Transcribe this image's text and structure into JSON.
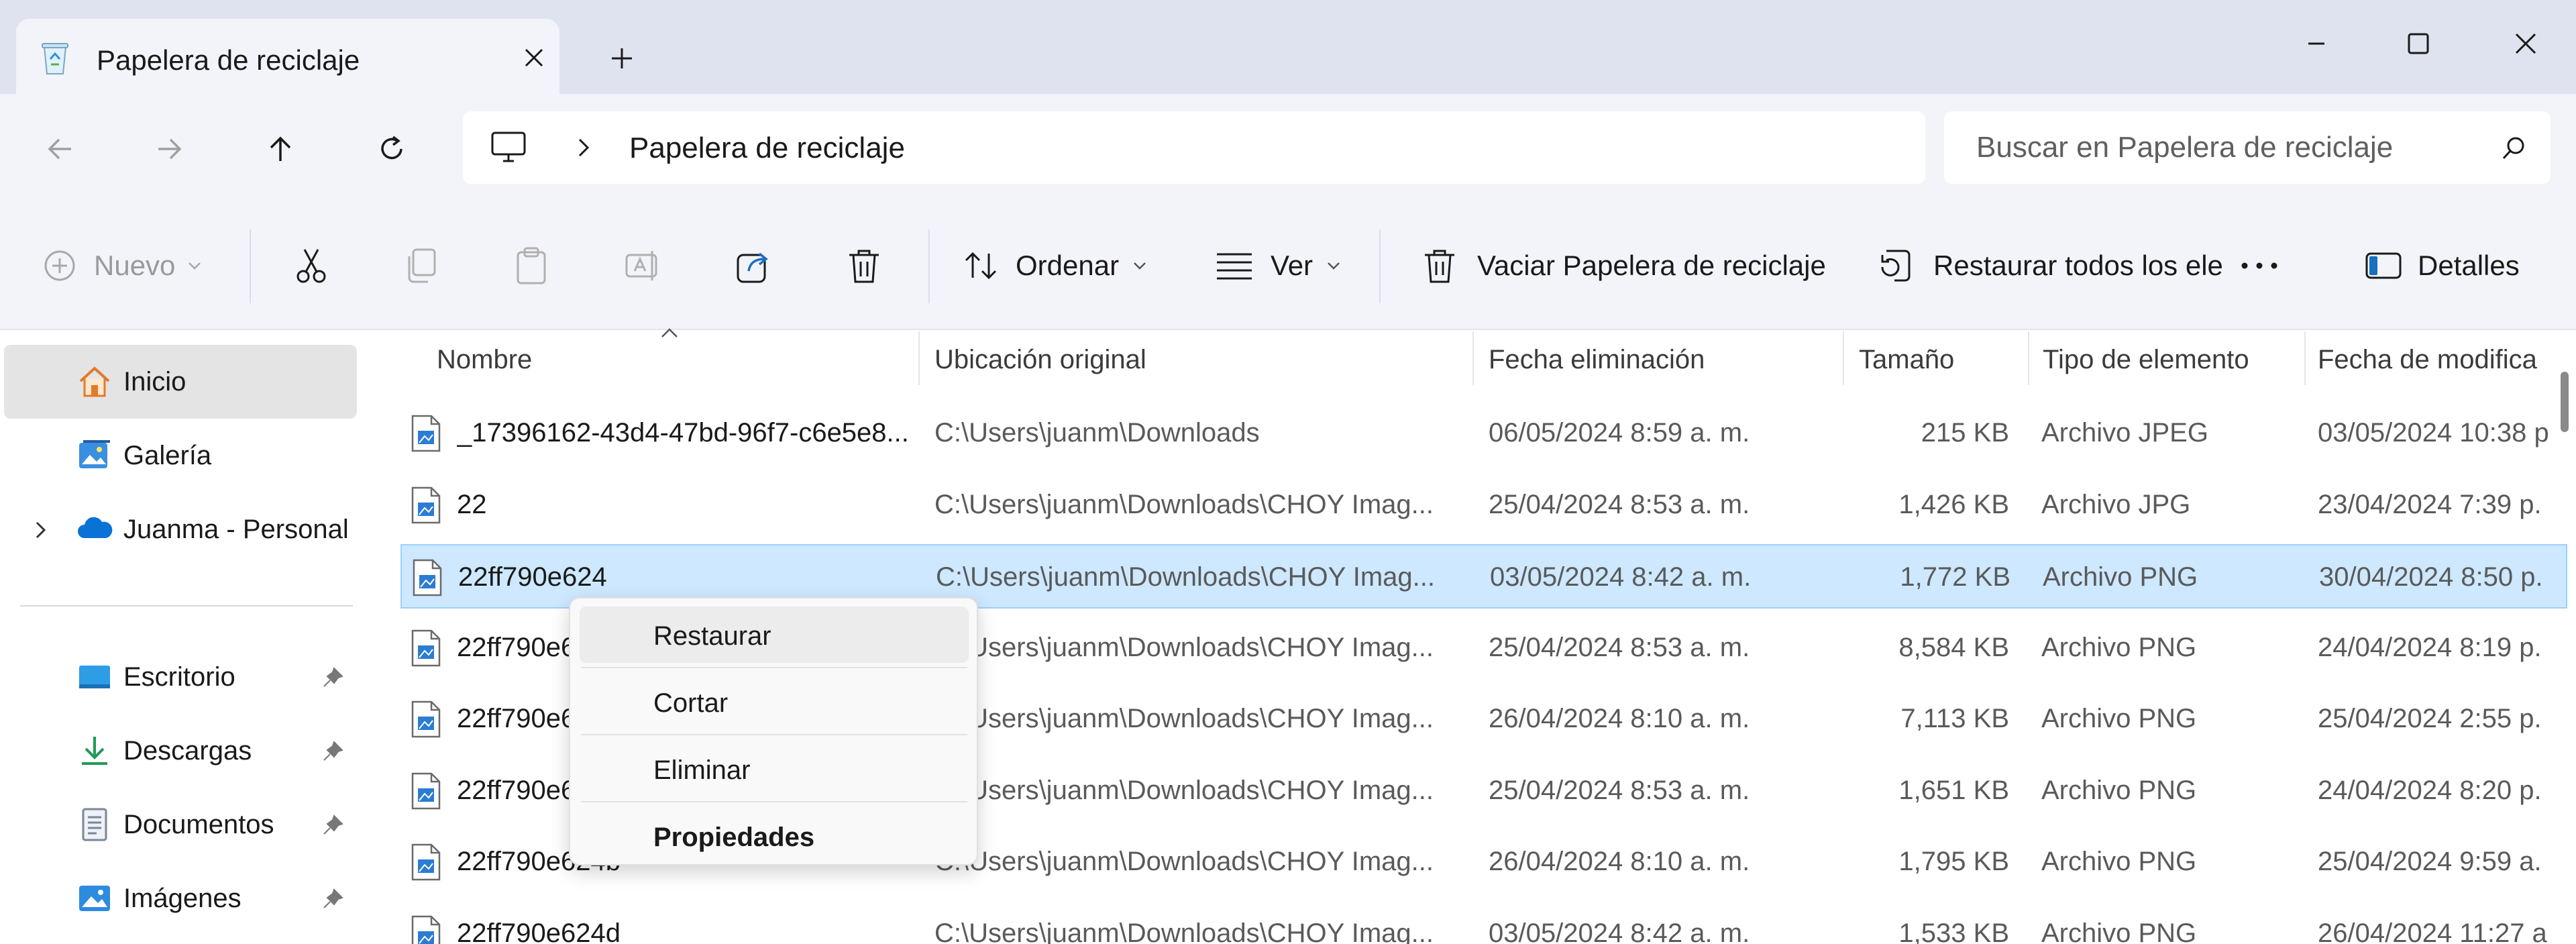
{
  "window": {
    "tab_title": "Papelera de reciclaje",
    "tab_icon": "recycle-bin-icon"
  },
  "navigation": {
    "breadcrumb": [
      "Papelera de reciclaje"
    ],
    "search_placeholder": "Buscar en Papelera de reciclaje"
  },
  "command_bar": {
    "new_label": "Nuevo",
    "sort_label": "Ordenar",
    "view_label": "Ver",
    "empty_bin_label": "Vaciar Papelera de reciclaje",
    "restore_all_label": "Restaurar todos los ele",
    "details_label": "Detalles"
  },
  "sidebar": {
    "items": [
      {
        "label": "Inicio",
        "icon": "home-icon"
      },
      {
        "label": "Galería",
        "icon": "gallery-icon"
      },
      {
        "label": "Juanma - Personal",
        "icon": "onedrive-cloud-icon"
      },
      {
        "label": "Escritorio",
        "icon": "desktop-icon"
      },
      {
        "label": "Descargas",
        "icon": "downloads-icon"
      },
      {
        "label": "Documentos",
        "icon": "documents-icon"
      },
      {
        "label": "Imágenes",
        "icon": "pictures-icon"
      }
    ]
  },
  "file_list": {
    "columns": [
      "Nombre",
      "Ubicación original",
      "Fecha eliminación",
      "Tamaño",
      "Tipo de elemento",
      "Fecha de modifica"
    ],
    "rows": [
      {
        "name": "_17396162-43d4-47bd-96f7-c6e5e8...",
        "location": "C:\\Users\\juanm\\Downloads",
        "deleted": "06/05/2024 8:59 a. m.",
        "size": "215 KB",
        "type": "Archivo JPEG",
        "modified": "03/05/2024 10:38 p"
      },
      {
        "name": "22",
        "location": "C:\\Users\\juanm\\Downloads\\CHOY Imag...",
        "deleted": "25/04/2024 8:53 a. m.",
        "size": "1,426 KB",
        "type": "Archivo JPG",
        "modified": "23/04/2024 7:39 p."
      },
      {
        "name": "22ff790e624",
        "location": "C:\\Users\\juanm\\Downloads\\CHOY Imag...",
        "deleted": "03/05/2024 8:42 a. m.",
        "size": "1,772 KB",
        "type": "Archivo PNG",
        "modified": "30/04/2024 8:50 p."
      },
      {
        "name": "22ff790e6",
        "location": "C:\\Users\\juanm\\Downloads\\CHOY Imag...",
        "deleted": "25/04/2024 8:53 a. m.",
        "size": "8,584 KB",
        "type": "Archivo PNG",
        "modified": "24/04/2024 8:19 p."
      },
      {
        "name": "22ff790e6",
        "location": "C:\\Users\\juanm\\Downloads\\CHOY Imag...",
        "deleted": "26/04/2024 8:10 a. m.",
        "size": "7,113 KB",
        "type": "Archivo PNG",
        "modified": "25/04/2024 2:55 p."
      },
      {
        "name": "22ff790e6",
        "location": "C:\\Users\\juanm\\Downloads\\CHOY Imag...",
        "deleted": "25/04/2024 8:53 a. m.",
        "size": "1,651 KB",
        "type": "Archivo PNG",
        "modified": "24/04/2024 8:20 p."
      },
      {
        "name": "22ff790e624b",
        "location": "C:\\Users\\juanm\\Downloads\\CHOY Imag...",
        "deleted": "26/04/2024 8:10 a. m.",
        "size": "1,795 KB",
        "type": "Archivo PNG",
        "modified": "25/04/2024 9:59 a."
      },
      {
        "name": "22ff790e624d",
        "location": "C:\\Users\\juanm\\Downloads\\CHOY Imag...",
        "deleted": "03/05/2024 8:42 a. m.",
        "size": "1,533 KB",
        "type": "Archivo PNG",
        "modified": "26/04/2024 11:27 a"
      }
    ]
  },
  "context_menu": {
    "items": [
      "Restaurar",
      "Cortar",
      "Eliminar",
      "Propiedades"
    ]
  },
  "colors": {
    "selection": "#cde8ff",
    "accent": "#0067c0",
    "title_bar": "#dfe3ef"
  }
}
